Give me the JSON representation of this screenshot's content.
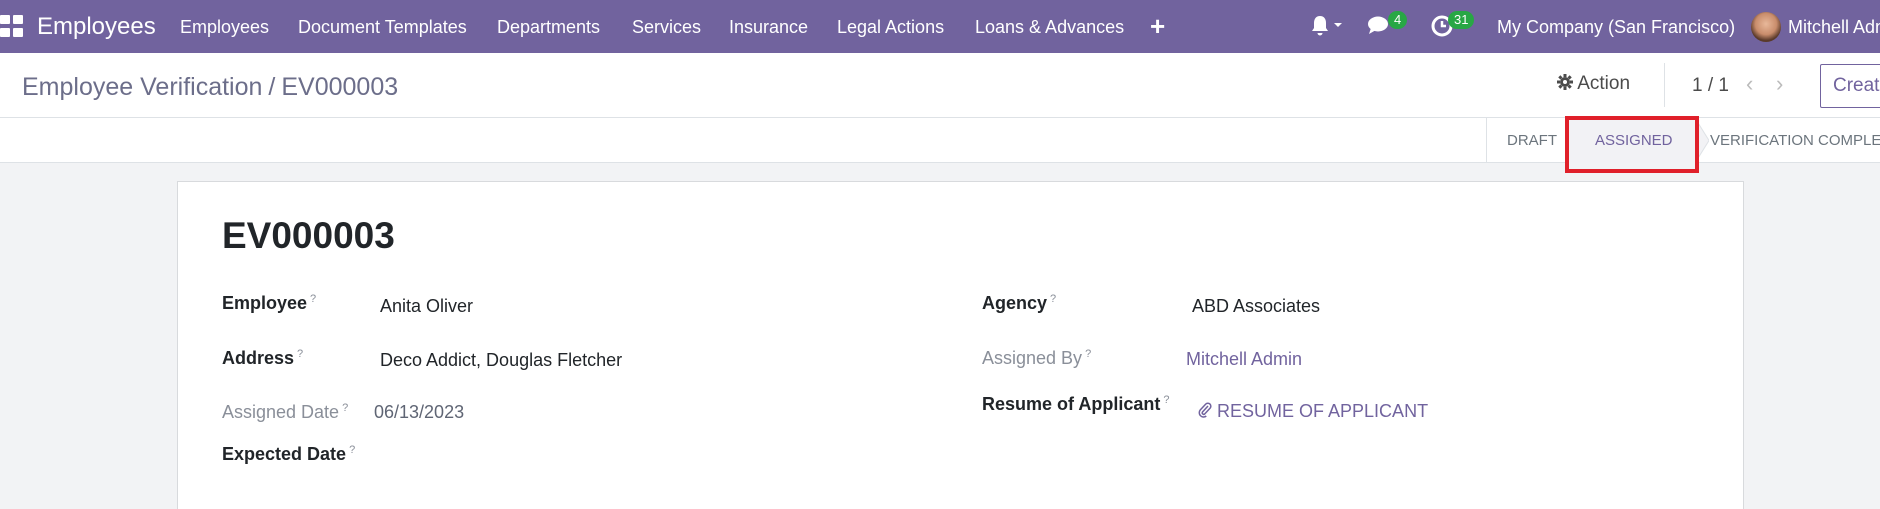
{
  "navbar": {
    "app_name": "Employees",
    "menu": [
      "Employees",
      "Document Templates",
      "Departments",
      "Services",
      "Insurance",
      "Legal Actions",
      "Loans & Advances"
    ],
    "messages_count": "4",
    "activities_count": "31",
    "company": "My Company (San Francisco)",
    "user": "Mitchell Admin"
  },
  "breadcrumb": {
    "parent": "Employee Verification",
    "separator": "/",
    "current": "EV000003"
  },
  "control": {
    "action_label": "Action",
    "pager": "1 / 1",
    "create_label": "Create"
  },
  "statusbar": {
    "stages": [
      "DRAFT",
      "ASSIGNED",
      "VERIFICATION COMPLETED"
    ],
    "current": "ASSIGNED"
  },
  "form": {
    "title": "EV000003",
    "employee_label": "Employee",
    "employee_value": "Anita Oliver",
    "address_label": "Address",
    "address_value": "Deco Addict, Douglas Fletcher",
    "assigned_date_label": "Assigned Date",
    "assigned_date_value": "06/13/2023",
    "expected_date_label": "Expected Date",
    "agency_label": "Agency",
    "agency_value": "ABD Associates",
    "assigned_by_label": "Assigned By",
    "assigned_by_value": "Mitchell Admin",
    "resume_label": "Resume of Applicant",
    "resume_value": "RESUME OF APPLICANT",
    "help_mark": "?"
  },
  "colors": {
    "brand": "#71639e",
    "badge": "#28a745",
    "highlight": "#e0202a"
  }
}
